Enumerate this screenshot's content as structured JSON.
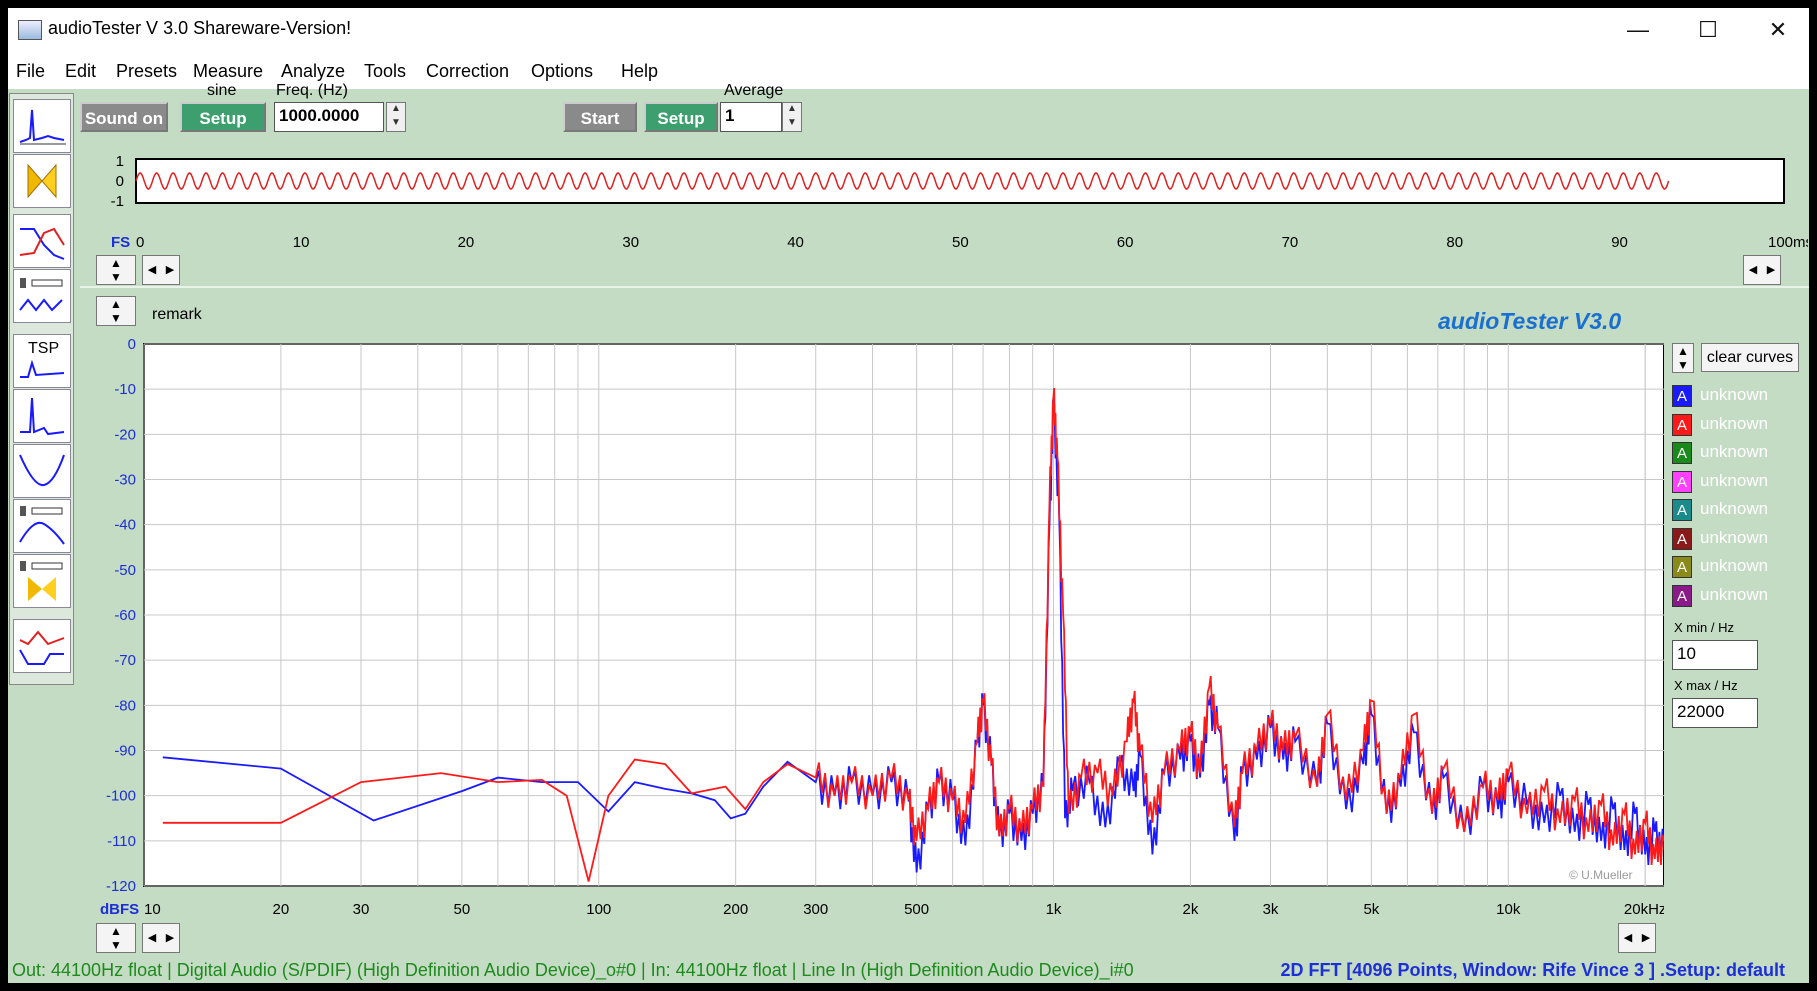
{
  "window": {
    "title": "audioTester  V 3.0 Shareware-Version!",
    "minimize_glyph": "—",
    "maximize_glyph": "☐",
    "close_glyph": "✕"
  },
  "menu": [
    "File",
    "Edit",
    "Presets",
    "Measure",
    "Analyze",
    "Tools",
    "Correction",
    "Options",
    "Help"
  ],
  "toolbar": {
    "sound_on_label": "Sound on",
    "signal_label": "sine",
    "setup_label": "Setup",
    "freq_label": "Freq. (Hz)",
    "freq_value": "1000.0000",
    "start_label": "Start",
    "setup2_label": "Setup",
    "average_label": "Average",
    "average_value": "1"
  },
  "side_tools": [
    "spectrum-tool-icon",
    "butterfly-tool-icon",
    "bode-tool-icon",
    "speaker-tool-icon",
    "tsp-tool-icon",
    "impulse-tool-icon",
    "impedance-tool-icon",
    "speaker-response-tool-icon",
    "speaker-butterfly-tool-icon",
    "correction-tool-icon"
  ],
  "tsp_label": "TSP",
  "scope": {
    "fs_label": "FS",
    "y_ticks": [
      "1",
      "0",
      "-1"
    ],
    "x_ticks": [
      "0",
      "10",
      "20",
      "30",
      "40",
      "50",
      "60",
      "70",
      "80",
      "90"
    ],
    "x_unit": "100ms",
    "signal_ms": 93,
    "signal_color": "#e02020"
  },
  "remark_label": "remark",
  "brand": "audioTester  V3.0",
  "copyright": "© U.Mueller",
  "legend": {
    "clear_label": "clear curves",
    "letter": "A",
    "items": [
      {
        "label": "unknown",
        "color": "#1a1aff"
      },
      {
        "label": "unknown",
        "color": "#ff1a1a"
      },
      {
        "label": "unknown",
        "color": "#1a8a1a"
      },
      {
        "label": "unknown",
        "color": "#ff40ff"
      },
      {
        "label": "unknown",
        "color": "#1a8a8a"
      },
      {
        "label": "unknown",
        "color": "#8a1a1a"
      },
      {
        "label": "unknown",
        "color": "#8a8a1a"
      },
      {
        "label": "unknown",
        "color": "#8a1a8a"
      }
    ]
  },
  "xrange": {
    "min_label": "X min / Hz",
    "min_value": "10",
    "max_label": "X max / Hz",
    "max_value": "22000"
  },
  "chart_data": {
    "type": "line",
    "title": "",
    "xlabel": "",
    "ylabel": "dBFS",
    "xscale": "log",
    "xlim": [
      10,
      22000
    ],
    "ylim": [
      -120,
      0
    ],
    "grid": true,
    "x_tick_labels": [
      "10",
      "20",
      "30",
      "50",
      "100",
      "200",
      "300",
      "500",
      "1k",
      "2k",
      "3k",
      "5k",
      "10k",
      "20kHz"
    ],
    "x_tick_values": [
      10,
      20,
      30,
      50,
      100,
      200,
      300,
      500,
      1000,
      2000,
      3000,
      5000,
      10000,
      20000
    ],
    "y_tick_labels": [
      "0",
      "-10",
      "-20",
      "-30",
      "-40",
      "-50",
      "-60",
      "-70",
      "-80",
      "-90",
      "-100",
      "-110",
      "-120"
    ],
    "series": [
      {
        "color": "#1a1aff",
        "points": [
          [
            11,
            -91.5
          ],
          [
            20,
            -94
          ],
          [
            32,
            -105.5
          ],
          [
            50,
            -99
          ],
          [
            60,
            -96
          ],
          [
            75,
            -97
          ],
          [
            90,
            -97
          ],
          [
            105,
            -103.5
          ],
          [
            120,
            -97
          ],
          [
            140,
            -98.5
          ],
          [
            160,
            -99.5
          ],
          [
            180,
            -101
          ],
          [
            195,
            -105
          ],
          [
            210,
            -104
          ],
          [
            230,
            -98
          ],
          [
            260,
            -92.5
          ],
          [
            300,
            -97
          ],
          [
            330,
            -100
          ],
          [
            360,
            -97
          ],
          [
            400,
            -100
          ],
          [
            440,
            -97
          ],
          [
            480,
            -101
          ],
          [
            500,
            -117
          ],
          [
            530,
            -103
          ],
          [
            560,
            -97
          ],
          [
            600,
            -101
          ],
          [
            640,
            -111
          ],
          [
            680,
            -88
          ],
          [
            700,
            -80
          ],
          [
            730,
            -93
          ],
          [
            760,
            -109
          ],
          [
            800,
            -104
          ],
          [
            850,
            -110
          ],
          [
            900,
            -104
          ],
          [
            950,
            -98
          ],
          [
            980,
            -40
          ],
          [
            1000,
            -12
          ],
          [
            1030,
            -40
          ],
          [
            1060,
            -105
          ],
          [
            1100,
            -99
          ],
          [
            1200,
            -97
          ],
          [
            1300,
            -107
          ],
          [
            1400,
            -93
          ],
          [
            1500,
            -99
          ],
          [
            1550,
            -91
          ],
          [
            1650,
            -113
          ],
          [
            1750,
            -95
          ],
          [
            1900,
            -92
          ],
          [
            2000,
            -88
          ],
          [
            2100,
            -96
          ],
          [
            2200,
            -80
          ],
          [
            2300,
            -85
          ],
          [
            2500,
            -110
          ],
          [
            2600,
            -95
          ],
          [
            2800,
            -92
          ],
          [
            3000,
            -85
          ],
          [
            3200,
            -92
          ],
          [
            3400,
            -88
          ],
          [
            3800,
            -98
          ],
          [
            4000,
            -84
          ],
          [
            4400,
            -103
          ],
          [
            4800,
            -93
          ],
          [
            5000,
            -82
          ],
          [
            5400,
            -104
          ],
          [
            5800,
            -98
          ],
          [
            6200,
            -86
          ],
          [
            6800,
            -104
          ],
          [
            7200,
            -96
          ],
          [
            8000,
            -108
          ],
          [
            8800,
            -98
          ],
          [
            9500,
            -103
          ],
          [
            10000,
            -97
          ],
          [
            11000,
            -102
          ],
          [
            12000,
            -106
          ],
          [
            13000,
            -100
          ],
          [
            14000,
            -108
          ],
          [
            15000,
            -102
          ],
          [
            16000,
            -110
          ],
          [
            17000,
            -103
          ],
          [
            18000,
            -112
          ],
          [
            19000,
            -104
          ],
          [
            20000,
            -113
          ],
          [
            21000,
            -108
          ],
          [
            22000,
            -112
          ]
        ]
      },
      {
        "color": "#ff1a1a",
        "points": [
          [
            11,
            -106
          ],
          [
            20,
            -106
          ],
          [
            30,
            -97
          ],
          [
            45,
            -95
          ],
          [
            60,
            -97
          ],
          [
            75,
            -96.5
          ],
          [
            85,
            -100
          ],
          [
            95,
            -119
          ],
          [
            105,
            -100
          ],
          [
            120,
            -92
          ],
          [
            140,
            -93
          ],
          [
            160,
            -99.5
          ],
          [
            190,
            -98
          ],
          [
            210,
            -103
          ],
          [
            230,
            -97
          ],
          [
            260,
            -93
          ],
          [
            300,
            -96
          ],
          [
            330,
            -100
          ],
          [
            360,
            -97
          ],
          [
            400,
            -100
          ],
          [
            440,
            -96
          ],
          [
            480,
            -101
          ],
          [
            500,
            -110
          ],
          [
            530,
            -103
          ],
          [
            560,
            -97
          ],
          [
            600,
            -101
          ],
          [
            640,
            -106
          ],
          [
            680,
            -88
          ],
          [
            700,
            -79
          ],
          [
            730,
            -93
          ],
          [
            760,
            -109
          ],
          [
            800,
            -103
          ],
          [
            850,
            -108
          ],
          [
            900,
            -103
          ],
          [
            950,
            -98
          ],
          [
            980,
            -35
          ],
          [
            1000,
            -11.5
          ],
          [
            1020,
            -25
          ],
          [
            1050,
            -60
          ],
          [
            1080,
            -104
          ],
          [
            1150,
            -96
          ],
          [
            1250,
            -95
          ],
          [
            1350,
            -100
          ],
          [
            1450,
            -88
          ],
          [
            1500,
            -79
          ],
          [
            1550,
            -90
          ],
          [
            1650,
            -106
          ],
          [
            1750,
            -95
          ],
          [
            1900,
            -90
          ],
          [
            2000,
            -86
          ],
          [
            2100,
            -95
          ],
          [
            2200,
            -76
          ],
          [
            2300,
            -85
          ],
          [
            2500,
            -107
          ],
          [
            2600,
            -95
          ],
          [
            2800,
            -90
          ],
          [
            3000,
            -84
          ],
          [
            3200,
            -90
          ],
          [
            3400,
            -87
          ],
          [
            3800,
            -98
          ],
          [
            4000,
            -82
          ],
          [
            4400,
            -101
          ],
          [
            4800,
            -90
          ],
          [
            5000,
            -79
          ],
          [
            5400,
            -104
          ],
          [
            5800,
            -96
          ],
          [
            6200,
            -82
          ],
          [
            6800,
            -104
          ],
          [
            7200,
            -94
          ],
          [
            8000,
            -108
          ],
          [
            8800,
            -98
          ],
          [
            9500,
            -101
          ],
          [
            10000,
            -95
          ],
          [
            11000,
            -104
          ],
          [
            12000,
            -99
          ],
          [
            13000,
            -106
          ],
          [
            14000,
            -101
          ],
          [
            15000,
            -108
          ],
          [
            16000,
            -102
          ],
          [
            17000,
            -111
          ],
          [
            18000,
            -104
          ],
          [
            19000,
            -113
          ],
          [
            20000,
            -106
          ],
          [
            21000,
            -114
          ],
          [
            22000,
            -110
          ]
        ]
      }
    ]
  },
  "status": {
    "left": "Out: 44100Hz float  | Digital Audio (S/PDIF) (High Definition Audio Device)_o#0 | In: 44100Hz float  | Line In (High Definition Audio Device)_i#0",
    "right": "2D FFT [4096 Points, Window: Rife Vince 3 ] .Setup:  default"
  }
}
